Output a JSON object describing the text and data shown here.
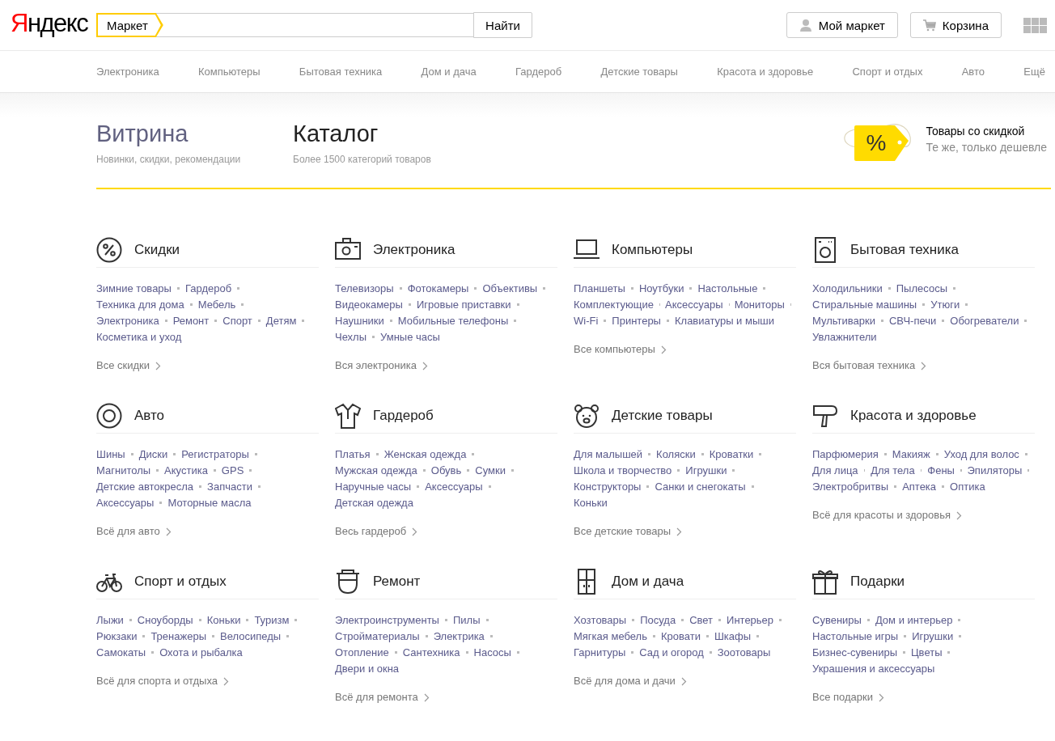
{
  "header": {
    "logo": "Яндекс",
    "search": {
      "service": "Маркет",
      "button": "Найти"
    },
    "buttons": [
      {
        "kind": "user",
        "label": "Мой маркет"
      },
      {
        "kind": "cart",
        "label": "Корзина"
      }
    ]
  },
  "nav": [
    "Электроника",
    "Компьютеры",
    "Бытовая техника",
    "Дом и дача",
    "Гардероб",
    "Детские товары",
    "Красота и здоровье",
    "Спорт и отдых",
    "Авто",
    "Ещё"
  ],
  "hero": {
    "tabs": [
      {
        "title": "Витрина",
        "subtitle": "Новинки, скидки, рекомендации",
        "selected": false
      },
      {
        "title": "Каталог",
        "subtitle": "Более 1500 категорий товаров",
        "selected": true
      }
    ],
    "promo": {
      "tag": "%",
      "title": "Товары со скидкой",
      "subtitle": "Те же, только дешевле"
    }
  },
  "categories": [
    {
      "title": "Скидки",
      "lines": [
        [
          "Зимние товары",
          "Гардероб"
        ],
        [
          "Техника для дома",
          "Мебель"
        ],
        [
          "Электроника",
          "Ремонт",
          "Спорт",
          "Детям"
        ],
        [
          "Косметика и уход"
        ]
      ],
      "all": "Все скидки"
    },
    {
      "title": "Электроника",
      "lines": [
        [
          "Телевизоры",
          "Фотокамеры",
          "Объективы"
        ],
        [
          "Видеокамеры",
          "Игровые приставки"
        ],
        [
          "Наушники",
          "Мобильные телефоны"
        ],
        [
          "Чехлы",
          "Умные часы"
        ]
      ],
      "all": "Вся электроника"
    },
    {
      "title": "Компьютеры",
      "lines": [
        [
          "Планшеты",
          "Ноутбуки",
          "Настольные"
        ],
        [
          "Комплектующие",
          "Аксессуары",
          "Мониторы"
        ],
        [
          "Wi-Fi",
          "Принтеры",
          "Клавиатуры и мыши"
        ]
      ],
      "all": "Все компьютеры"
    },
    {
      "title": "Бытовая техника",
      "lines": [
        [
          "Холодильники",
          "Пылесосы"
        ],
        [
          "Стиральные машины",
          "Утюги"
        ],
        [
          "Мультиварки",
          "СВЧ-печи",
          "Обогреватели"
        ],
        [
          "Увлажнители"
        ]
      ],
      "all": "Вся бытовая техника"
    },
    {
      "title": "Авто",
      "lines": [
        [
          "Шины",
          "Диски",
          "Регистраторы"
        ],
        [
          "Магнитолы",
          "Акустика",
          "GPS"
        ],
        [
          "Детские автокресла",
          "Запчасти"
        ],
        [
          "Аксессуары",
          "Моторные масла"
        ]
      ],
      "all": "Всё для авто"
    },
    {
      "title": "Гардероб",
      "lines": [
        [
          "Платья",
          "Женская одежда"
        ],
        [
          "Мужская одежда",
          "Обувь",
          "Сумки"
        ],
        [
          "Наручные часы",
          "Аксессуары"
        ],
        [
          "Детская одежда"
        ]
      ],
      "all": "Весь гардероб"
    },
    {
      "title": "Детские товары",
      "lines": [
        [
          "Для малышей",
          "Коляски",
          "Кроватки"
        ],
        [
          "Школа и творчество",
          "Игрушки"
        ],
        [
          "Конструкторы",
          "Санки и снегокаты"
        ],
        [
          "Коньки"
        ]
      ],
      "all": "Все детские товары"
    },
    {
      "title": "Красота и здоровье",
      "lines": [
        [
          "Парфюмерия",
          "Макияж",
          "Уход для волос"
        ],
        [
          "Для лица",
          "Для тела",
          "Фены",
          "Эпиляторы"
        ],
        [
          "Электробритвы",
          "Аптека",
          "Оптика"
        ]
      ],
      "all": "Всё для красоты и здоровья"
    },
    {
      "title": "Спорт и отдых",
      "lines": [
        [
          "Лыжи",
          "Сноуборды",
          "Коньки",
          "Туризм"
        ],
        [
          "Рюкзаки",
          "Тренажеры",
          "Велосипеды"
        ],
        [
          "Самокаты",
          "Охота и рыбалка"
        ]
      ],
      "all": "Всё для спорта и отдыха"
    },
    {
      "title": "Ремонт",
      "lines": [
        [
          "Электроинструменты",
          "Пилы"
        ],
        [
          "Стройматериалы",
          "Электрика"
        ],
        [
          "Отопление",
          "Сантехника",
          "Насосы"
        ],
        [
          "Двери и окна"
        ]
      ],
      "all": "Всё для ремонта"
    },
    {
      "title": "Дом и дача",
      "lines": [
        [
          "Хозтовары",
          "Посуда",
          "Свет",
          "Интерьер"
        ],
        [
          "Мягкая мебель",
          "Кровати",
          "Шкафы"
        ],
        [
          "Гарнитуры",
          "Сад и огород",
          "Зоотовары"
        ]
      ],
      "all": "Всё для дома и дачи"
    },
    {
      "title": "Подарки",
      "lines": [
        [
          "Сувениры",
          "Дом и интерьер"
        ],
        [
          "Настольные игры",
          "Игрушки"
        ],
        [
          "Бизнес-сувениры",
          "Цветы"
        ],
        [
          "Украшения и аксессуары"
        ]
      ],
      "all": "Все подарки"
    }
  ]
}
